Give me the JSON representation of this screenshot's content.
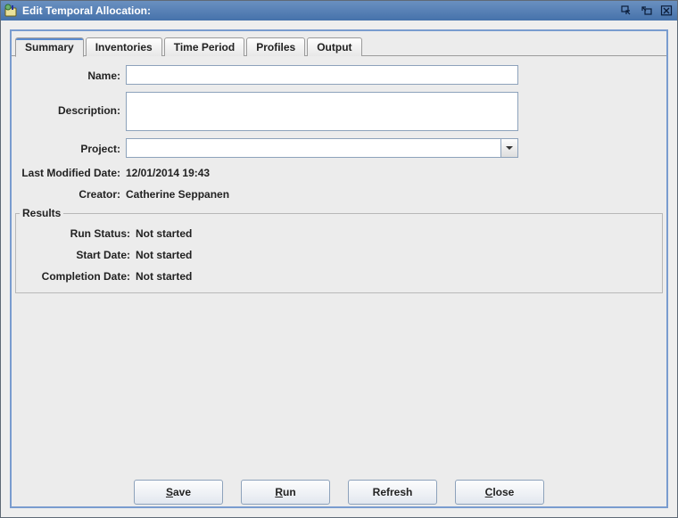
{
  "window": {
    "title": "Edit Temporal Allocation:"
  },
  "tabs": {
    "summary": "Summary",
    "inventories": "Inventories",
    "time_period": "Time Period",
    "profiles": "Profiles",
    "output": "Output"
  },
  "form": {
    "name_label": "Name:",
    "name_value": "",
    "description_label": "Description:",
    "description_value": "",
    "project_label": "Project:",
    "project_value": "",
    "last_modified_label": "Last Modified Date:",
    "last_modified_value": "12/01/2014 19:43",
    "creator_label": "Creator:",
    "creator_value": "Catherine Seppanen"
  },
  "results": {
    "legend": "Results",
    "run_status_label": "Run Status:",
    "run_status_value": "Not started",
    "start_date_label": "Start Date:",
    "start_date_value": "Not started",
    "completion_date_label": "Completion Date:",
    "completion_date_value": "Not started"
  },
  "buttons": {
    "save": "ave",
    "save_mn": "S",
    "run": "un",
    "run_mn": "R",
    "refresh": "Refresh",
    "close": "lose",
    "close_mn": "C"
  }
}
